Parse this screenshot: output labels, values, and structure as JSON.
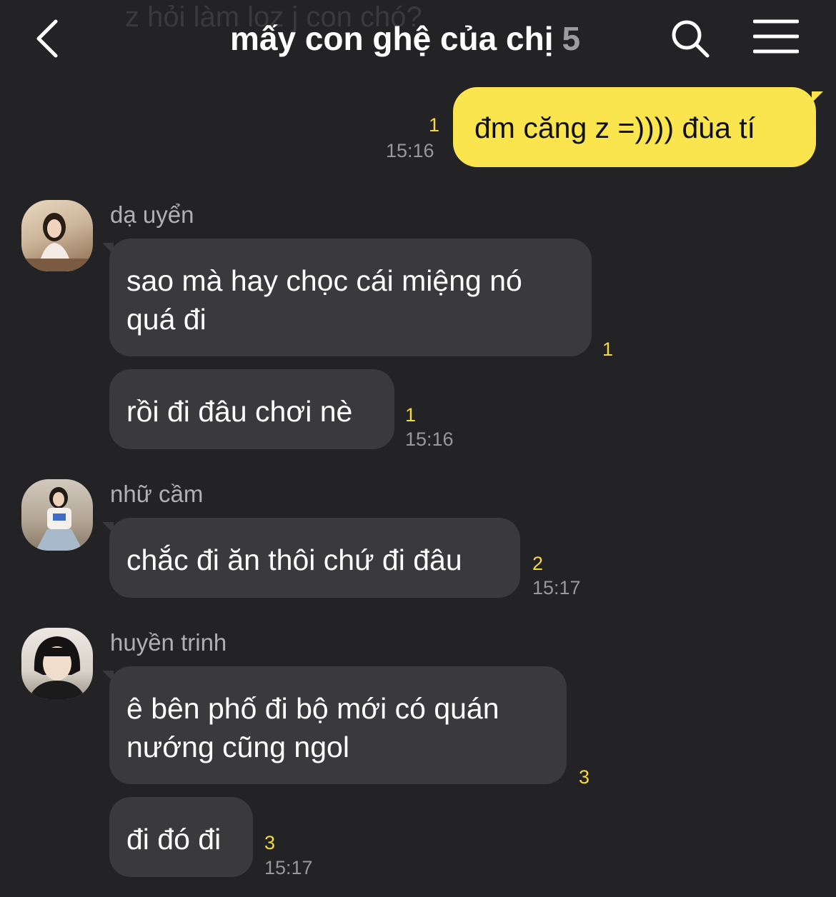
{
  "header": {
    "ghost_text": "z hỏi làm loz j con chó?",
    "title": "mấy con ghệ của chị",
    "member_count": "5",
    "back_icon": "chevron-left-icon",
    "search_icon": "search-icon",
    "menu_icon": "hamburger-menu-icon"
  },
  "colors": {
    "background": "#232326",
    "bubble_in": "#3a3a3c",
    "bubble_out": "#fae54e",
    "unread": "#f4d940"
  },
  "messages": {
    "m0": {
      "text": "đm căng z =)))) đùa tí",
      "unread": "1",
      "time": "15:16"
    },
    "g1": {
      "sender": "dạ uyển",
      "m1": {
        "line1": "sao mà hay chọc cái miệng nó",
        "line2": "quá đi",
        "unread": "1"
      },
      "m2": {
        "text": "rồi đi đâu chơi nè",
        "unread": "1",
        "time": "15:16"
      }
    },
    "g2": {
      "sender": "nhữ cầm",
      "m1": {
        "text": "chắc đi ăn thôi chứ đi đâu",
        "unread": "2",
        "time": "15:17"
      }
    },
    "g3": {
      "sender": "huyền trinh",
      "m1": {
        "line1": "ê bên phố đi bộ mới có quán",
        "line2": "nướng cũng ngol",
        "unread": "3"
      },
      "m2": {
        "text": "đi đó đi",
        "unread": "3",
        "time": "15:17"
      }
    }
  }
}
